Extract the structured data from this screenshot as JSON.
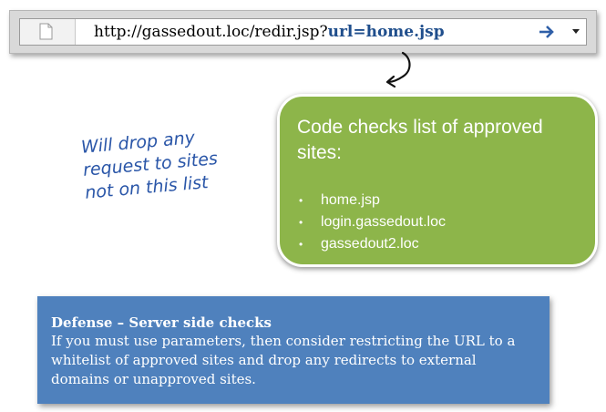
{
  "browser": {
    "url_prefix": "http://gassedout.loc/redir.jsp?",
    "url_param": "url=home.jsp",
    "page_icon": "page-icon",
    "go_icon": "arrow-right-icon",
    "menu_icon": "chevron-down-icon"
  },
  "callout": {
    "title": "Code checks list of approved sites:",
    "items": [
      "home.jsp",
      "login.gassedout.loc",
      "gassedout2.loc"
    ],
    "bullet": "•",
    "color": "#8db54a"
  },
  "note": {
    "lines": [
      "Will drop any",
      "request to sites",
      "not on this list"
    ],
    "color": "#2a56a8"
  },
  "defense": {
    "title": "Defense – Server side checks",
    "body": "If you must use parameters, then consider restricting the URL to a whitelist of approved sites and drop any redirects to external domains or unapproved sites.",
    "color": "#4f81bd"
  }
}
